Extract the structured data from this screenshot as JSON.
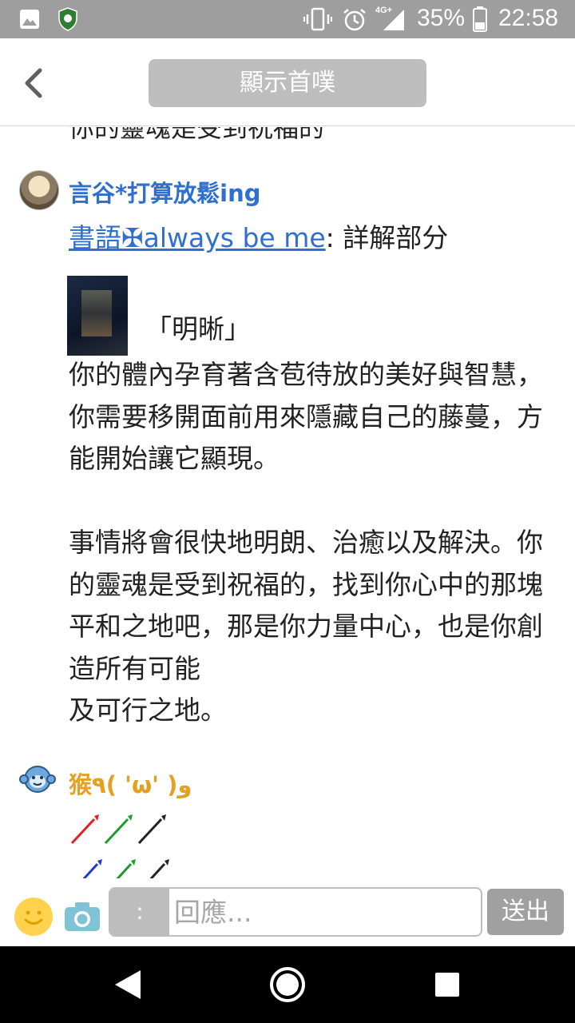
{
  "status_bar": {
    "network": "4G+",
    "battery": "35%",
    "time": "22:58"
  },
  "header": {
    "show_first_label": "顯示首噗"
  },
  "thread": {
    "cut_off_text": "你的靈魂是受到祝福的",
    "reply": {
      "username": "言谷*打算放鬆ing",
      "mention_link": "書語✠always be me",
      "mention_suffix": ": 詳解部分",
      "card_title": "「明晰」",
      "body": "你的體內孕育著含苞待放的美好與智慧，你需要移開面前用來隱藏自己的藤蔓，方能開始讓它顯現。\n\n事情將會很快地明朗、治癒以及解決。你的靈魂是受到祝福的，找到你心中的那塊平和之地吧，那是你力量中心，也是你創造所有可能\n及可行之地。"
    },
    "next_reply": {
      "username": "猴٩( 'ω' )و"
    }
  },
  "input_bar": {
    "prefix": ":",
    "placeholder": "回應...",
    "send_label": "送出"
  },
  "colors": {
    "status_bar_bg": "#9e9e9e",
    "link_blue": "#2e6fcf",
    "username2_orange": "#e4a021"
  }
}
